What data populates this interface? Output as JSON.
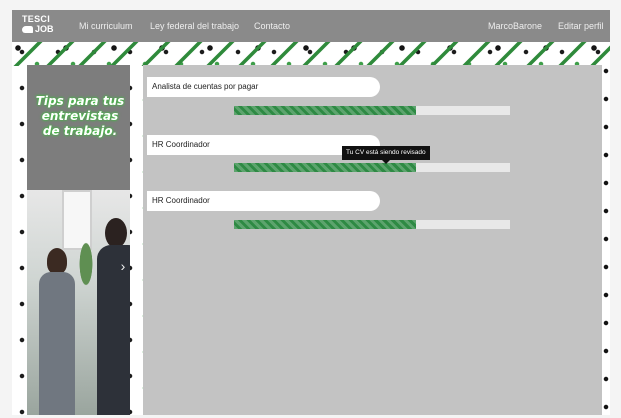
{
  "navbar": {
    "logo_line1": "TESCI",
    "logo_line2": "JOB",
    "links": [
      "Mi curriculum",
      "Ley federal del trabajo",
      "Contacto"
    ],
    "username": "MarcoBarone",
    "edit_profile": "Editar perfil"
  },
  "promo": {
    "text": "Tips para tus entrevistas de trabajo.",
    "next_glyph": "›"
  },
  "applications": [
    {
      "title": "Analista de cuentas por pagar",
      "progress": 0.66
    },
    {
      "title": "HR Coordinador",
      "progress": 0.66
    },
    {
      "title": "HR Coordinador",
      "progress": 0.66
    }
  ],
  "tooltip": "Tu CV está siendo revisado",
  "colors": {
    "navbar": "#8a8a8a",
    "progress_fill": "#2e8a44",
    "progress_track": "#e8e8e8",
    "content_bg": "#c3c3c3"
  }
}
